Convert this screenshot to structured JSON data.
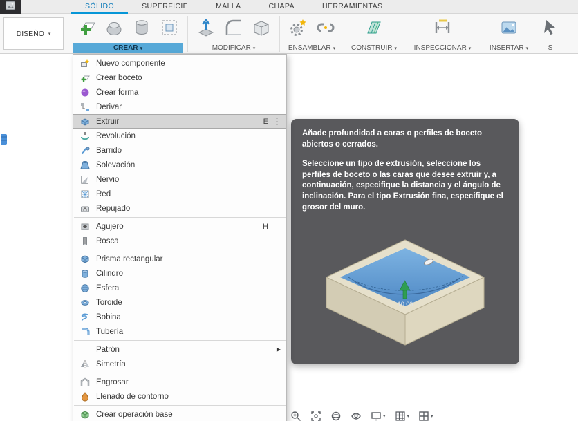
{
  "tabs": [
    "SÓLIDO",
    "SUPERFICIE",
    "MALLA",
    "CHAPA",
    "HERRAMIENTAS"
  ],
  "design": {
    "label": "DISEÑO"
  },
  "toolbar": {
    "groups": [
      {
        "label": "CREAR",
        "icons": [
          "create-sketch",
          "create-form",
          "primitive-cylinder",
          "bounding-box"
        ],
        "active": true
      },
      {
        "label": "MODIFICAR",
        "icons": [
          "press-pull",
          "fillet",
          "shell"
        ]
      },
      {
        "label": "ENSAMBLAR",
        "icons": [
          "new-component",
          "joint"
        ]
      },
      {
        "label": "CONSTRUIR",
        "icons": [
          "construction-plane"
        ]
      },
      {
        "label": "INSPECCIONAR",
        "icons": [
          "measure"
        ]
      },
      {
        "label": "INSERTAR",
        "icons": [
          "insert-image"
        ]
      },
      {
        "label": "S",
        "icons": [
          "select"
        ]
      }
    ]
  },
  "menu": {
    "items": [
      {
        "label": "Nuevo componente",
        "icon": "new-component"
      },
      {
        "label": "Crear boceto",
        "icon": "create-sketch"
      },
      {
        "label": "Crear forma",
        "icon": "create-form"
      },
      {
        "label": "Derivar",
        "icon": "derive"
      },
      {
        "label": "Extruir",
        "icon": "extrude",
        "shortcut": "E",
        "selected": true
      },
      {
        "label": "Revolución",
        "icon": "revolve"
      },
      {
        "label": "Barrido",
        "icon": "sweep"
      },
      {
        "label": "Solevación",
        "icon": "loft"
      },
      {
        "label": "Nervio",
        "icon": "rib"
      },
      {
        "label": "Red",
        "icon": "web"
      },
      {
        "label": "Repujado",
        "icon": "emboss"
      },
      {
        "label": "Agujero",
        "icon": "hole",
        "shortcut": "H"
      },
      {
        "label": "Rosca",
        "icon": "thread"
      },
      {
        "label": "Prisma rectangular",
        "icon": "box"
      },
      {
        "label": "Cilindro",
        "icon": "cylinder"
      },
      {
        "label": "Esfera",
        "icon": "sphere"
      },
      {
        "label": "Toroide",
        "icon": "torus"
      },
      {
        "label": "Bobina",
        "icon": "coil"
      },
      {
        "label": "Tubería",
        "icon": "pipe"
      },
      {
        "label": "Patrón",
        "icon": "",
        "submenu": true
      },
      {
        "label": "Simetría",
        "icon": "mirror"
      },
      {
        "label": "Engrosar",
        "icon": "thicken"
      },
      {
        "label": "Llenado de contorno",
        "icon": "boundary-fill"
      },
      {
        "label": "Crear operación base",
        "icon": "base-feature"
      }
    ]
  },
  "tooltip": {
    "p1": "Añade profundidad a caras o perfiles de boceto abiertos o cerrados.",
    "p2": "Seleccione un tipo de extrusión, seleccione los perfiles de boceto o las caras que desee extruir y, a continuación, especifique la distancia y el ángulo de inclinación. Para el tipo Extrusión fina, especifique el grosor del muro.",
    "dimension_label": "10.00"
  },
  "bottom_bar": {
    "icons": [
      "zoom",
      "fit",
      "orbit",
      "look-at",
      "display-settings",
      "grid-settings",
      "viewports"
    ]
  },
  "colors": {
    "accent": "#0696d7",
    "panel_highlight": "#57a9d8",
    "tooltip_bg": "#59595c",
    "selection_gray": "#d6d6d6"
  }
}
